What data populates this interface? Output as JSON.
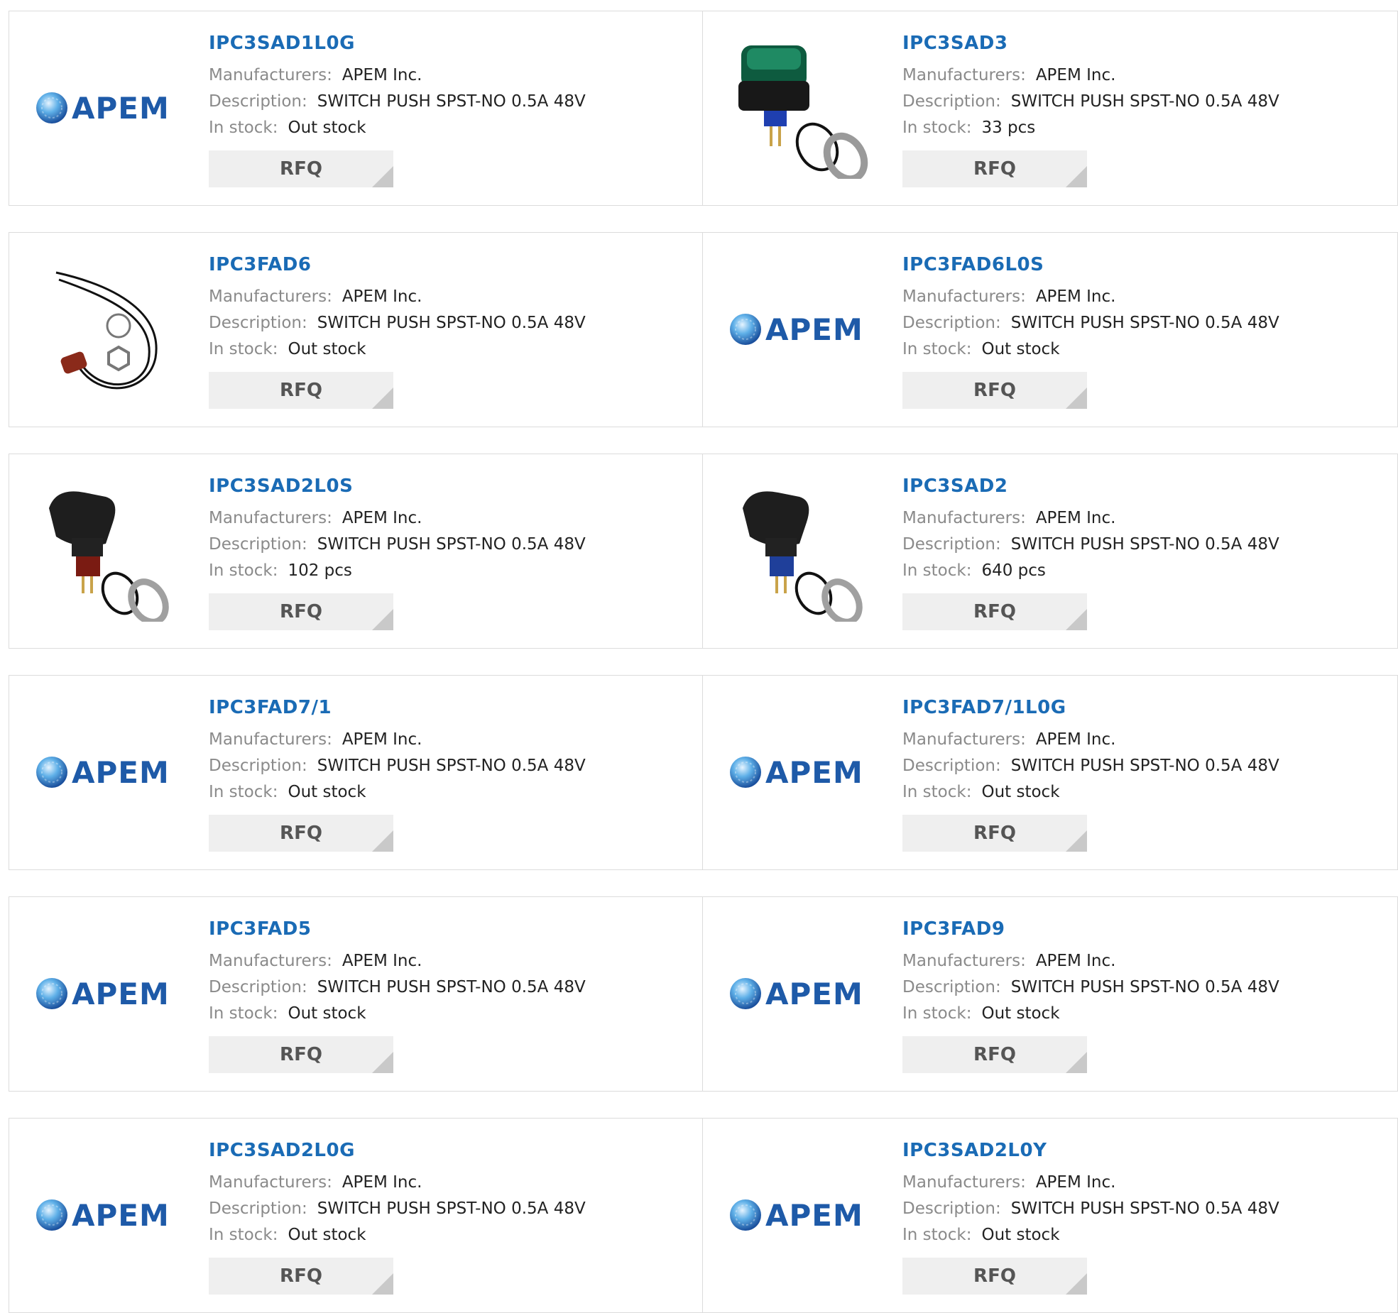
{
  "labels": {
    "manufacturers": "Manufacturers:",
    "description": "Description:",
    "stock": "In stock:",
    "rfq": "RFQ"
  },
  "colors": {
    "link": "#1a6bb5",
    "apem_blue": "#1e5aa8",
    "button_bg": "#efefef"
  },
  "products": [
    {
      "part": "IPC3SAD1L0G",
      "manufacturer": "APEM Inc.",
      "description": "SWITCH PUSH SPST-NO 0.5A 48V",
      "stock": "Out stock",
      "image": "apem-logo"
    },
    {
      "part": "IPC3SAD3",
      "manufacturer": "APEM Inc.",
      "description": "SWITCH PUSH SPST-NO 0.5A 48V",
      "stock": "33 pcs",
      "image": "switch-green"
    },
    {
      "part": "IPC3FAD6",
      "manufacturer": "APEM Inc.",
      "description": "SWITCH PUSH SPST-NO 0.5A 48V",
      "stock": "Out stock",
      "image": "switch-wired"
    },
    {
      "part": "IPC3FAD6L0S",
      "manufacturer": "APEM Inc.",
      "description": "SWITCH PUSH SPST-NO 0.5A 48V",
      "stock": "Out stock",
      "image": "apem-logo"
    },
    {
      "part": "IPC3SAD2L0S",
      "manufacturer": "APEM Inc.",
      "description": "SWITCH PUSH SPST-NO 0.5A 48V",
      "stock": "102 pcs",
      "image": "switch-red"
    },
    {
      "part": "IPC3SAD2",
      "manufacturer": "APEM Inc.",
      "description": "SWITCH PUSH SPST-NO 0.5A 48V",
      "stock": "640 pcs",
      "image": "switch-blue"
    },
    {
      "part": "IPC3FAD7/1",
      "manufacturer": "APEM Inc.",
      "description": "SWITCH PUSH SPST-NO 0.5A 48V",
      "stock": "Out stock",
      "image": "apem-logo"
    },
    {
      "part": "IPC3FAD7/1L0G",
      "manufacturer": "APEM Inc.",
      "description": "SWITCH PUSH SPST-NO 0.5A 48V",
      "stock": "Out stock",
      "image": "apem-logo"
    },
    {
      "part": "IPC3FAD5",
      "manufacturer": "APEM Inc.",
      "description": "SWITCH PUSH SPST-NO 0.5A 48V",
      "stock": "Out stock",
      "image": "apem-logo"
    },
    {
      "part": "IPC3FAD9",
      "manufacturer": "APEM Inc.",
      "description": "SWITCH PUSH SPST-NO 0.5A 48V",
      "stock": "Out stock",
      "image": "apem-logo"
    },
    {
      "part": "IPC3SAD2L0G",
      "manufacturer": "APEM Inc.",
      "description": "SWITCH PUSH SPST-NO 0.5A 48V",
      "stock": "Out stock",
      "image": "apem-logo"
    },
    {
      "part": "IPC3SAD2L0Y",
      "manufacturer": "APEM Inc.",
      "description": "SWITCH PUSH SPST-NO 0.5A 48V",
      "stock": "Out stock",
      "image": "apem-logo"
    }
  ]
}
